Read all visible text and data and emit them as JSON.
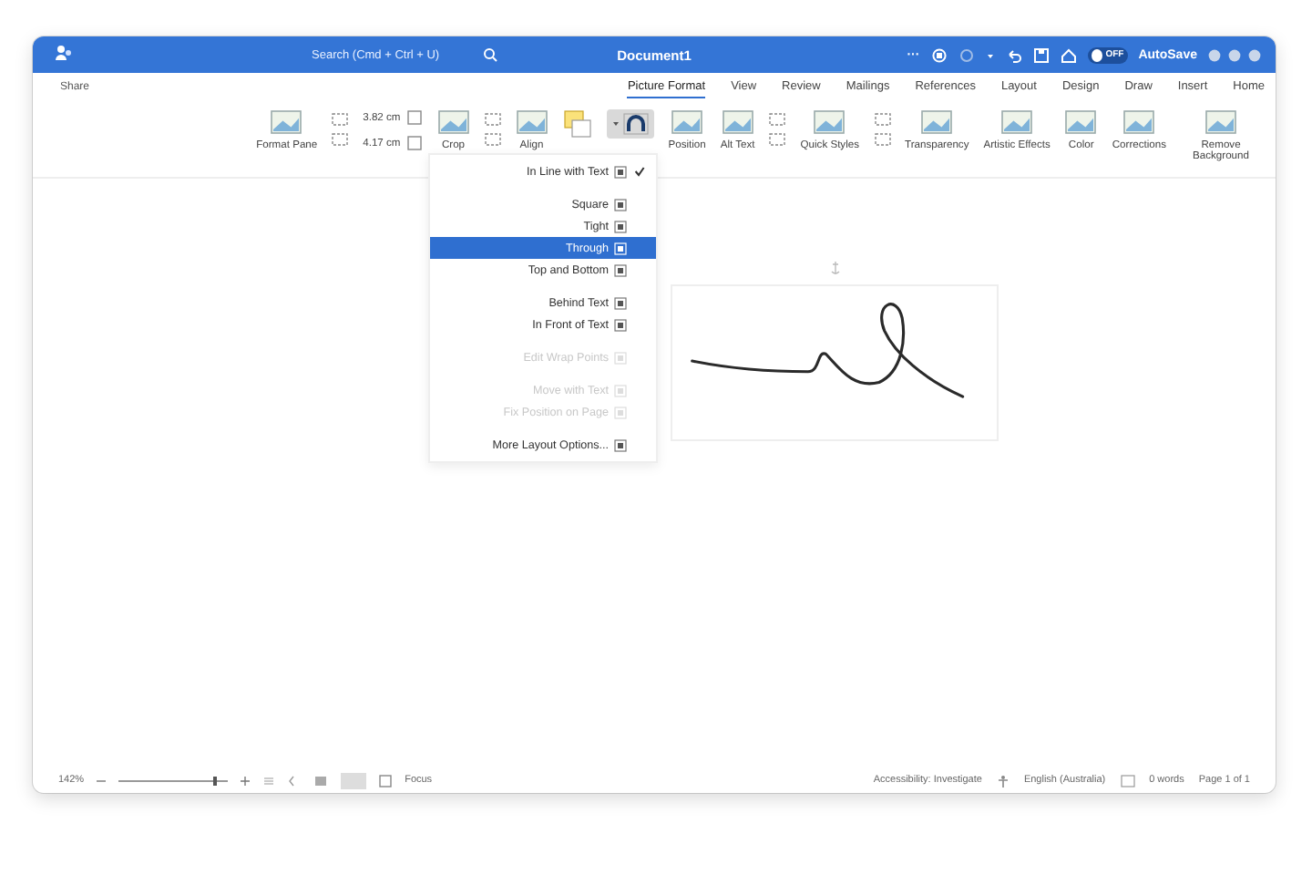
{
  "window": {
    "title": "Document1"
  },
  "titlebar": {
    "autosave_label": "AutoSave",
    "autosave": {
      "on": false,
      "label": "OFF"
    },
    "more": "···",
    "search": {
      "placeholder": "Search (Cmd + Ctrl + U)"
    }
  },
  "share": "Share",
  "tabs": [
    {
      "label": "Picture Format",
      "selected": true
    },
    {
      "label": "View",
      "selected": false
    },
    {
      "label": "Review",
      "selected": false
    },
    {
      "label": "Mailings",
      "selected": false
    },
    {
      "label": "References",
      "selected": false
    },
    {
      "label": "Layout",
      "selected": false
    },
    {
      "label": "Design",
      "selected": false
    },
    {
      "label": "Draw",
      "selected": false
    },
    {
      "label": "Insert",
      "selected": false
    },
    {
      "label": "Home",
      "selected": false
    }
  ],
  "ribbon": [
    {
      "kind": "large",
      "label": "Format Pane"
    },
    {
      "kind": "stack"
    },
    {
      "kind": "size",
      "height": "3.82 cm",
      "width": "4.17 cm"
    },
    {
      "kind": "large",
      "label": "Crop"
    },
    {
      "kind": "stack"
    },
    {
      "kind": "large",
      "label": "Align"
    },
    {
      "kind": "arrange"
    },
    {
      "kind": "wrap",
      "selected": true
    },
    {
      "kind": "large",
      "label": "Position"
    },
    {
      "kind": "large",
      "label": "Alt Text"
    },
    {
      "kind": "stack"
    },
    {
      "kind": "large",
      "label": "Quick Styles"
    },
    {
      "kind": "stack"
    },
    {
      "kind": "large",
      "label": "Transparency"
    },
    {
      "kind": "large",
      "label": "Artistic Effects"
    },
    {
      "kind": "large",
      "label": "Color"
    },
    {
      "kind": "large",
      "label": "Corrections"
    },
    {
      "kind": "large",
      "label": "Remove Background"
    }
  ],
  "wrap_menu": [
    {
      "kind": "item",
      "label": "In Line with Text",
      "checked": true,
      "disabled": false,
      "selected": false
    },
    {
      "kind": "separator"
    },
    {
      "kind": "item",
      "label": "Square",
      "checked": false,
      "disabled": false,
      "selected": false
    },
    {
      "kind": "item",
      "label": "Tight",
      "checked": false,
      "disabled": false,
      "selected": false
    },
    {
      "kind": "item",
      "label": "Through",
      "checked": false,
      "disabled": false,
      "selected": true
    },
    {
      "kind": "item",
      "label": "Top and Bottom",
      "checked": false,
      "disabled": false,
      "selected": false
    },
    {
      "kind": "separator"
    },
    {
      "kind": "item",
      "label": "Behind Text",
      "checked": false,
      "disabled": false,
      "selected": false
    },
    {
      "kind": "item",
      "label": "In Front of Text",
      "checked": false,
      "disabled": false,
      "selected": false
    },
    {
      "kind": "separator"
    },
    {
      "kind": "item",
      "label": "Edit Wrap Points",
      "checked": false,
      "disabled": true,
      "selected": false
    },
    {
      "kind": "separator"
    },
    {
      "kind": "item",
      "label": "Move with Text",
      "checked": false,
      "disabled": true,
      "selected": false
    },
    {
      "kind": "item",
      "label": "Fix Position on Page",
      "checked": false,
      "disabled": true,
      "selected": false
    },
    {
      "kind": "separator"
    },
    {
      "kind": "item",
      "label": "More Layout Options...",
      "checked": false,
      "disabled": false,
      "selected": false
    }
  ],
  "status_bar": {
    "zoom": "142%",
    "focus": "Focus",
    "right": [
      "Accessibility: Investigate",
      "English (Australia)",
      "0 words",
      "Page 1 of 1"
    ]
  }
}
